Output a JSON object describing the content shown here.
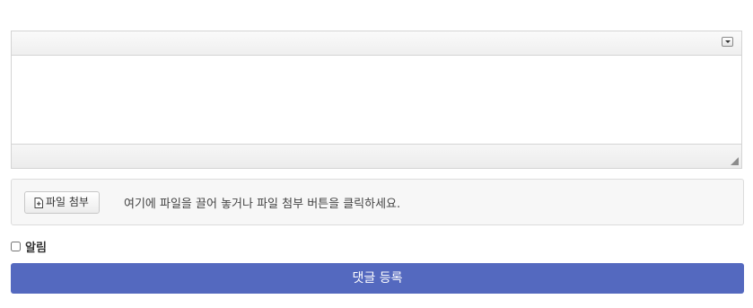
{
  "editor": {
    "toolbar_toggle_icon": "chevron-down-icon",
    "content": "",
    "resize_icon": "resize-corner-icon"
  },
  "attach": {
    "button_label": "파일 첨부",
    "button_icon": "file-plus-icon",
    "hint": "여기에 파일을 끌어 놓거나 파일 첨부 버튼을 클릭하세요."
  },
  "notify": {
    "label": "알림",
    "checked": false
  },
  "submit": {
    "label": "댓글 등록"
  },
  "colors": {
    "submit_bg": "#5469bf",
    "attach_bg": "#f7f7f7"
  }
}
